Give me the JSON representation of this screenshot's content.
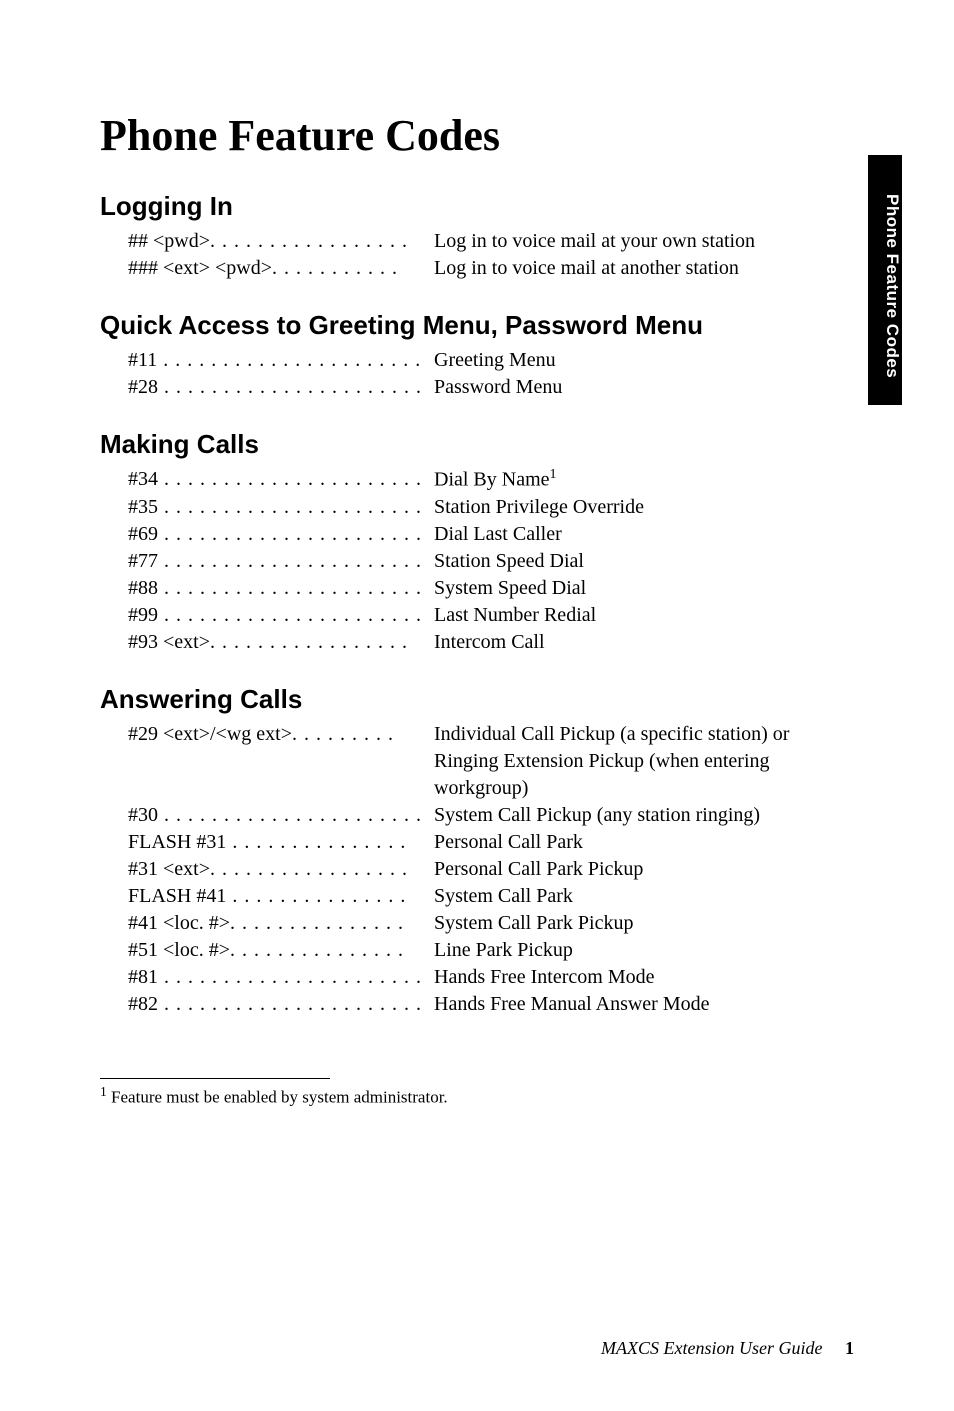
{
  "side_tab": "Phone Feature Codes",
  "title": "Phone Feature Codes",
  "sections": [
    {
      "heading": "Logging In",
      "entries": [
        {
          "code": "## <pwd>",
          "dots": ". . . . . . . . . . . . . . . . .",
          "desc": "Log in to voice mail at your own station"
        },
        {
          "code": "### <ext> <pwd>",
          "dots": ". . . . . . . . . . .",
          "desc": "Log in to voice mail at another station"
        }
      ]
    },
    {
      "heading": "Quick Access to Greeting Menu, Password Menu",
      "entries": [
        {
          "code": "#11",
          "dots": " . . . . . . . . . . . . . . . . . . . . . .",
          "desc": "Greeting Menu"
        },
        {
          "code": "#28",
          "dots": " . . . . . . . . . . . . . . . . . . . . . .",
          "desc": "Password Menu"
        }
      ]
    },
    {
      "heading": "Making Calls",
      "entries": [
        {
          "code": "#34",
          "dots": " . . . . . . . . . . . . . . . . . . . . . .",
          "desc": "Dial By Name",
          "sup": "1"
        },
        {
          "code": "#35",
          "dots": " . . . . . . . . . . . . . . . . . . . . . .",
          "desc": "Station Privilege Override"
        },
        {
          "code": "#69",
          "dots": " . . . . . . . . . . . . . . . . . . . . . .",
          "desc": "Dial Last Caller"
        },
        {
          "code": "#77",
          "dots": " . . . . . . . . . . . . . . . . . . . . . .",
          "desc": "Station Speed Dial"
        },
        {
          "code": "#88",
          "dots": " . . . . . . . . . . . . . . . . . . . . . .",
          "desc": "System Speed Dial"
        },
        {
          "code": "#99",
          "dots": " . . . . . . . . . . . . . . . . . . . . . .",
          "desc": "Last Number Redial"
        },
        {
          "code": "#93 <ext>",
          "dots": ". . . . . . . . . . . . . . . . .",
          "desc": "Intercom Call"
        }
      ]
    },
    {
      "heading": "Answering Calls",
      "entries": [
        {
          "code": "#29 <ext>/<wg ext>",
          "dots": ". . . . . . . . .",
          "desc": "Individual Call Pickup (a specific station) or Ringing Extension Pickup (when entering workgroup)"
        },
        {
          "code": "#30",
          "dots": " . . . . . . . . . . . . . . . . . . . . . .",
          "desc": "System Call Pickup (any station ringing)"
        },
        {
          "code": "FLASH #31",
          "dots": " . . . . . . . . . . . . . . .",
          "desc": "Personal Call Park"
        },
        {
          "code": "#31 <ext>",
          "dots": ". . . . . . . . . . . . . . . . .",
          "desc": "Personal Call Park Pickup"
        },
        {
          "code": "FLASH #41",
          "dots": " . . . . . . . . . . . . . . .",
          "desc": "System Call Park"
        },
        {
          "code": "#41 <loc. #>",
          "dots": ". . . . . . . . . . . . . . .",
          "desc": "System Call Park Pickup"
        },
        {
          "code": "#51 <loc. #>",
          "dots": ". . . . . . . . . . . . . . .",
          "desc": "Line Park Pickup"
        },
        {
          "code": "#81",
          "dots": " . . . . . . . . . . . . . . . . . . . . . .",
          "desc": "Hands Free Intercom Mode"
        },
        {
          "code": "#82",
          "dots": " . . . . . . . . . . . . . . . . . . . . . .",
          "desc": "Hands Free Manual Answer Mode"
        }
      ]
    }
  ],
  "footnote": {
    "marker": "1",
    "text": "Feature must be enabled by system administrator."
  },
  "footer": {
    "book": "MAXCS Extension User Guide",
    "page": "1"
  }
}
